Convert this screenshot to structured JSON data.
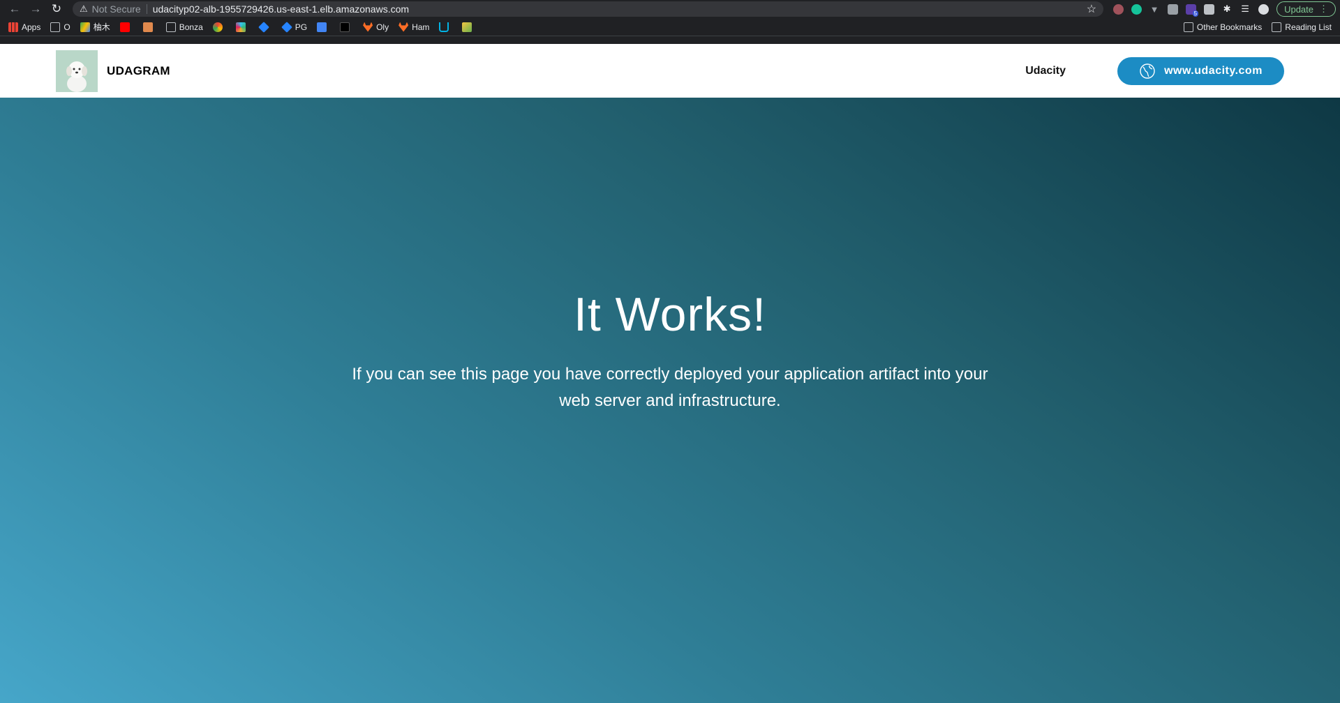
{
  "browser": {
    "security_label": "Not Secure",
    "url": "udacityp02-alb-1955729426.us-east-1.elb.amazonaws.com",
    "update_label": "Update",
    "extension_badge": "5"
  },
  "bookmarks": {
    "items": [
      "Apps",
      "O",
      "柚木",
      "Bonza",
      "PG",
      "Oly",
      "Ham"
    ],
    "other_label": "Other Bookmarks",
    "reading_list_label": "Reading List"
  },
  "site": {
    "brand": "UDAGRAM",
    "nav_link": "Udacity",
    "cta_label": "www.udacity.com"
  },
  "hero": {
    "title": "It Works!",
    "message": "If you can see this page you have correctly deployed your application artifact into your web server and infrastructure."
  },
  "colors": {
    "cta": "#1c8cc4",
    "gradient_light": "#46a6c9",
    "gradient_dark": "#0e3844"
  }
}
